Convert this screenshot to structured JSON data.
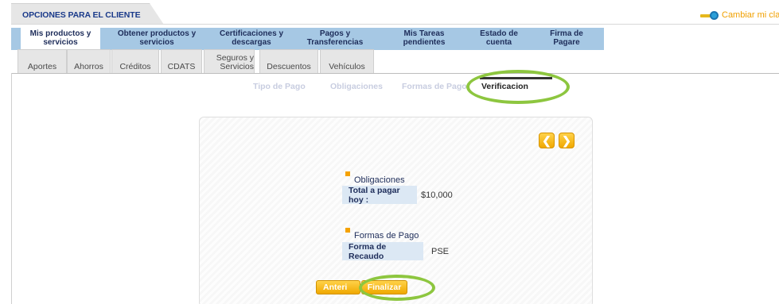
{
  "header": {
    "title": "OPCIONES PARA EL CLIENTE",
    "change_key": "Cambiar mi clave"
  },
  "main_nav": [
    "Mis productos y servicios",
    "Obtener productos y servicios",
    "Certificaciones y descargas",
    "Pagos y Transferencias",
    "Mis Tareas pendientes",
    "Estado de cuenta",
    "Firma de Pagare"
  ],
  "main_nav_lines": [
    [
      "Mis productos y",
      "servicios"
    ],
    [
      "Obtener productos y",
      "servicios"
    ],
    [
      "Certificaciones y",
      "descargas"
    ],
    [
      "Pagos y",
      "Transferencias"
    ],
    [
      "Mis Tareas",
      "pendientes"
    ],
    [
      "Estado de",
      "cuenta"
    ],
    [
      "Firma de",
      "Pagare"
    ]
  ],
  "sub_nav": [
    [
      "Aportes"
    ],
    [
      "Ahorros"
    ],
    [
      "Créditos"
    ],
    [
      "CDATS"
    ],
    [
      "Seguros y",
      "Servicios"
    ],
    [
      "Descuentos"
    ],
    [
      "Vehículos"
    ]
  ],
  "steps": [
    "Tipo de Pago",
    "Obligaciones",
    "Formas de Pago",
    "Verificacion"
  ],
  "active_step": "Verificacion",
  "nav_buttons": {
    "prev": "❮",
    "next": "❯"
  },
  "obligations": {
    "title": "Obligaciones",
    "label": "Total a pagar hoy :",
    "value": "$10,000"
  },
  "payment_forms": {
    "title": "Formas de Pago",
    "label": "Forma de Recaudo",
    "value": "PSE"
  },
  "actions": {
    "previous": "Anteri",
    "finish": "Finalizar"
  },
  "colors": {
    "nav_blue": "#a6c8e4",
    "accent_orange": "#f5a200",
    "highlight_green": "#8dc63f",
    "text_navy": "#1e2d5a"
  }
}
